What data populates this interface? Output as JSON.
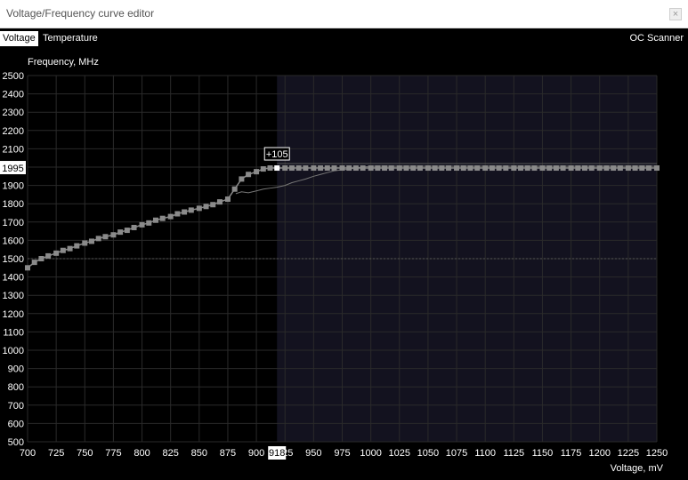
{
  "window": {
    "title": "Voltage/Frequency curve editor",
    "close_label": "×"
  },
  "tabs": [
    {
      "label": "Voltage",
      "active": true
    },
    {
      "label": "Temperature",
      "active": false
    }
  ],
  "oc_scanner_label": "OC Scanner",
  "colors": {
    "background": "#000000",
    "locked_region": "#13121f",
    "curve": "#8a8a8a",
    "grid": "#2a2a2a"
  },
  "chart_data": {
    "type": "line",
    "ylabel": "Frequency, MHz",
    "xlabel": "Voltage, mV",
    "xlim": [
      700,
      1250
    ],
    "ylim": [
      500,
      2500
    ],
    "xticks": [
      700,
      725,
      750,
      775,
      800,
      825,
      850,
      875,
      900,
      925,
      950,
      975,
      1000,
      1025,
      1050,
      1075,
      1100,
      1125,
      1150,
      1175,
      1200,
      1225,
      1250
    ],
    "yticks": [
      500,
      600,
      700,
      800,
      900,
      1000,
      1100,
      1200,
      1300,
      1400,
      1500,
      1600,
      1700,
      1800,
      1900,
      2000,
      2100,
      2200,
      2300,
      2400,
      2500
    ],
    "reference_line_y": 1500,
    "locked_voltage": 918,
    "locked_frequency": 1995,
    "locked_voltage_label": "918",
    "locked_frequency_label": "1995",
    "offset_label": "+105",
    "locked_region_start_x": 918,
    "series": [
      {
        "kind": "curve-points",
        "x": [
          700,
          706,
          712,
          718,
          725,
          731,
          737,
          743,
          750,
          756,
          762,
          768,
          775,
          781,
          787,
          793,
          800,
          806,
          812,
          818,
          825,
          831,
          837,
          843,
          850,
          856,
          862,
          868,
          875,
          881,
          887,
          893,
          900,
          906,
          912,
          918,
          925,
          931,
          937,
          943,
          950,
          956,
          962,
          968,
          975,
          981,
          987,
          993,
          1000,
          1006,
          1012,
          1018,
          1025,
          1031,
          1037,
          1043,
          1050,
          1056,
          1062,
          1068,
          1075,
          1081,
          1087,
          1093,
          1100,
          1106,
          1112,
          1118,
          1125,
          1131,
          1137,
          1143,
          1150,
          1156,
          1162,
          1168,
          1175,
          1181,
          1187,
          1193,
          1200,
          1206,
          1212,
          1218,
          1225,
          1231,
          1237,
          1243,
          1250
        ],
        "y": [
          1450,
          1480,
          1500,
          1515,
          1530,
          1545,
          1555,
          1570,
          1585,
          1595,
          1610,
          1620,
          1630,
          1645,
          1655,
          1670,
          1685,
          1695,
          1710,
          1720,
          1730,
          1745,
          1755,
          1765,
          1775,
          1785,
          1795,
          1810,
          1825,
          1880,
          1935,
          1960,
          1975,
          1990,
          1995,
          1995,
          1995,
          1995,
          1995,
          1995,
          1995,
          1995,
          1995,
          1995,
          1995,
          1995,
          1995,
          1995,
          1995,
          1995,
          1995,
          1995,
          1995,
          1995,
          1995,
          1995,
          1995,
          1995,
          1995,
          1995,
          1995,
          1995,
          1995,
          1995,
          1995,
          1995,
          1995,
          1995,
          1995,
          1995,
          1995,
          1995,
          1995,
          1995,
          1995,
          1995,
          1995,
          1995,
          1995,
          1995,
          1995,
          1995,
          1995,
          1995,
          1995,
          1995,
          1995,
          1995,
          1995
        ]
      },
      {
        "kind": "default-curve",
        "x": [
          882,
          887,
          893,
          900,
          906,
          912,
          918,
          925,
          931,
          937,
          943,
          950,
          956,
          962,
          968,
          975,
          981,
          987,
          993,
          1000,
          1250
        ],
        "y": [
          1855,
          1865,
          1860,
          1870,
          1880,
          1885,
          1890,
          1900,
          1915,
          1925,
          1935,
          1950,
          1960,
          1970,
          1980,
          1985,
          1990,
          1995,
          2000,
          2005,
          2005
        ]
      }
    ]
  }
}
